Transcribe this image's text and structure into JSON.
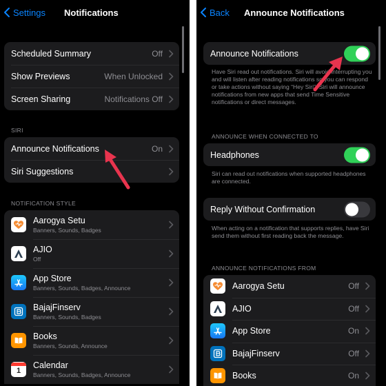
{
  "left": {
    "back_label": "Settings",
    "title": "Notifications",
    "group1": [
      {
        "label": "Scheduled Summary",
        "value": "Off"
      },
      {
        "label": "Show Previews",
        "value": "When Unlocked"
      },
      {
        "label": "Screen Sharing",
        "value": "Notifications Off"
      }
    ],
    "siri_header": "SIRI",
    "siri_rows": [
      {
        "label": "Announce Notifications",
        "value": "On"
      },
      {
        "label": "Siri Suggestions",
        "value": ""
      }
    ],
    "style_header": "NOTIFICATION STYLE",
    "apps": [
      {
        "name": "Aarogya Setu",
        "sub": "Banners, Sounds, Badges",
        "icon": "aarogya-setu-icon"
      },
      {
        "name": "AJIO",
        "sub": "Off",
        "icon": "ajio-icon"
      },
      {
        "name": "App Store",
        "sub": "Banners, Sounds, Badges, Announce",
        "icon": "app-store-icon"
      },
      {
        "name": "BajajFinserv",
        "sub": "Banners, Sounds, Badges",
        "icon": "bajaj-finserv-icon"
      },
      {
        "name": "Books",
        "sub": "Banners, Sounds, Announce",
        "icon": "books-icon"
      },
      {
        "name": "Calendar",
        "sub": "Banners, Sounds, Badges, Announce",
        "icon": "calendar-icon"
      }
    ]
  },
  "right": {
    "back_label": "Back",
    "title": "Announce Notifications",
    "announce": {
      "label": "Announce Notifications",
      "on": true
    },
    "announce_footnote": "Have Siri read out notifications. Siri will avoid interrupting you and will listen after reading notifications so you can respond or take actions without saying “Hey Siri”. Siri will announce notifications from new apps that send Time Sensitive notifications or direct messages.",
    "connected_header": "ANNOUNCE WHEN CONNECTED TO",
    "headphones": {
      "label": "Headphones",
      "on": true
    },
    "headphones_footnote": "Siri can read out notifications when supported headphones are connected.",
    "reply": {
      "label": "Reply Without Confirmation",
      "on": false
    },
    "reply_footnote": "When acting on a notification that supports replies, have Siri send them without first reading back the message.",
    "from_header": "ANNOUNCE NOTIFICATIONS FROM",
    "apps": [
      {
        "name": "Aarogya Setu",
        "value": "Off",
        "icon": "aarogya-setu-icon"
      },
      {
        "name": "AJIO",
        "value": "Off",
        "icon": "ajio-icon"
      },
      {
        "name": "App Store",
        "value": "On",
        "icon": "app-store-icon"
      },
      {
        "name": "BajajFinserv",
        "value": "Off",
        "icon": "bajaj-finserv-icon"
      },
      {
        "name": "Books",
        "value": "On",
        "icon": "books-icon"
      }
    ]
  },
  "colors": {
    "accent": "#0a84ff",
    "toggle_on": "#30d158",
    "annotation_arrow": "#e8344e",
    "background": "#000000",
    "cell": "#1c1c1e",
    "secondary_text": "#8e8e93"
  },
  "calendar_icon_day": "1"
}
